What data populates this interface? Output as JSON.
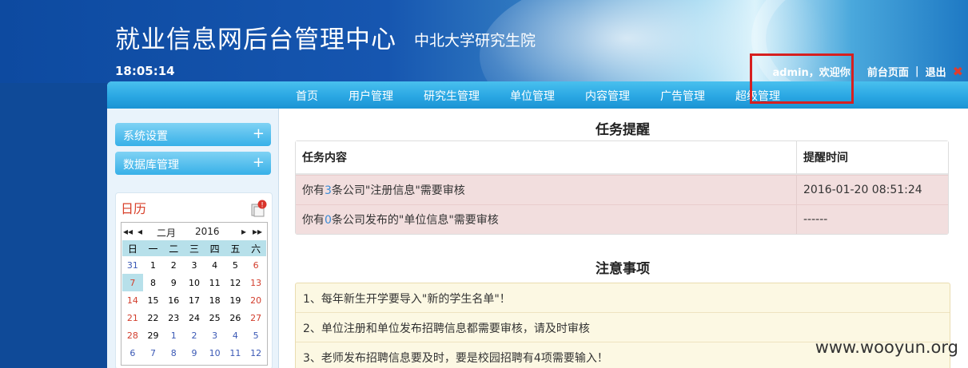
{
  "header": {
    "title": "就业信息网后台管理中心",
    "subtitle": "中北大学研究生院",
    "clock": "18:05:14",
    "welcome": "admin，欢迎你！",
    "front_page": "前台页面",
    "separator": "|",
    "logout": "退出",
    "close_glyph": "✖"
  },
  "nav": {
    "items": [
      "首页",
      "用户管理",
      "研究生管理",
      "单位管理",
      "内容管理",
      "广告管理",
      "超级管理"
    ]
  },
  "sidebar": {
    "menus": [
      {
        "label": "系统设置",
        "icon": "+"
      },
      {
        "label": "数据库管理",
        "icon": "+"
      }
    ],
    "calendar": {
      "title": "日历",
      "month": "二月",
      "year": "2016",
      "weekdays": [
        "日",
        "一",
        "二",
        "三",
        "四",
        "五",
        "六"
      ],
      "weeks": [
        [
          "31",
          "1",
          "2",
          "3",
          "4",
          "5",
          "6"
        ],
        [
          "7",
          "8",
          "9",
          "10",
          "11",
          "12",
          "13"
        ],
        [
          "14",
          "15",
          "16",
          "17",
          "18",
          "19",
          "20"
        ],
        [
          "21",
          "22",
          "23",
          "24",
          "25",
          "26",
          "27"
        ],
        [
          "28",
          "29",
          "1",
          "2",
          "3",
          "4",
          "5"
        ],
        [
          "6",
          "7",
          "8",
          "9",
          "10",
          "11",
          "12"
        ]
      ],
      "today": "7"
    }
  },
  "tasks": {
    "title": "任务提醒",
    "col_content": "任务内容",
    "col_time": "提醒时间",
    "rows": [
      {
        "pre": "你有",
        "num": "3",
        "post": "条公司\"注册信息\"需要审核",
        "time": "2016-01-20 08:51:24"
      },
      {
        "pre": "你有",
        "num": "0",
        "post": "条公司发布的\"单位信息\"需要审核",
        "time": "------"
      }
    ]
  },
  "notes": {
    "title": "注意事项",
    "items": [
      "1、每年新生开学要导入\"新的学生名单\"！",
      "2、单位注册和单位发布招聘信息都需要审核，请及时审核",
      "3、老师发布招聘信息要及时，要是校园招聘有4项需要输入！"
    ]
  },
  "watermark": "www.wooyun.org",
  "colors": {
    "nav": "#2aa7e3",
    "highlight_box": "#d62020",
    "task_row": "#f2dede",
    "notes_bg": "#fcf8e3"
  }
}
